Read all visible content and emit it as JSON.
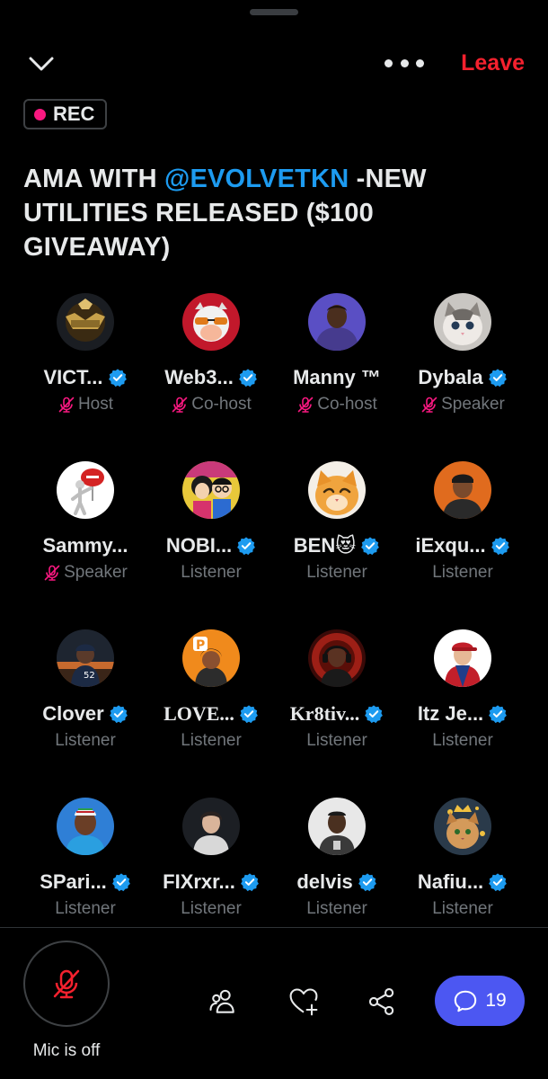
{
  "header": {
    "leave_label": "Leave",
    "collapse_icon": "chevron-down-icon",
    "more_icon": "more-horizontal-icon"
  },
  "recording": {
    "label": "REC",
    "dot_color": "#f91880"
  },
  "space": {
    "title_prefix": "AMA WITH ",
    "title_mention": "@EVOLVETKN",
    "title_suffix": " -NEW UTILITIES RELEASED ($100 GIVEAWAY)"
  },
  "participants": [
    {
      "name": "VICT...",
      "verified": true,
      "role": "Host",
      "muted": true,
      "avatar": "victor-logo-avatar"
    },
    {
      "name": "Web3...",
      "verified": true,
      "role": "Co-host",
      "muted": true,
      "avatar": "tiger-with-sunglasses-avatar"
    },
    {
      "name": "Manny ™",
      "verified": false,
      "role": "Co-host",
      "muted": true,
      "avatar": "man-in-hoodie-avatar"
    },
    {
      "name": "Dybala",
      "verified": true,
      "role": "Speaker",
      "muted": true,
      "avatar": "kitten-avatar"
    },
    {
      "name": "Sammy...",
      "verified": false,
      "role": "Speaker",
      "muted": true,
      "avatar": "urgent-sign-figure-avatar"
    },
    {
      "name": "NOBI...",
      "verified": true,
      "role": "Listener",
      "muted": false,
      "avatar": "cartoon-characters-avatar"
    },
    {
      "name": "BEN😻",
      "verified": true,
      "role": "Listener",
      "muted": false,
      "avatar": "orange-cat-avatar"
    },
    {
      "name": "iExqu...",
      "verified": true,
      "role": "Listener",
      "muted": false,
      "avatar": "man-with-cap-avatar"
    },
    {
      "name": "Clover",
      "verified": true,
      "role": "Listener",
      "muted": false,
      "avatar": "person-at-sunset-avatar"
    },
    {
      "name": "LOVE...",
      "verified": true,
      "role": "Listener",
      "muted": false,
      "avatar": "cartoon-woman-p-sign-avatar"
    },
    {
      "name": "Kr8tiv...",
      "verified": true,
      "role": "Listener",
      "muted": false,
      "avatar": "man-with-headphones-avatar"
    },
    {
      "name": "Itz Je...",
      "verified": true,
      "role": "Listener",
      "muted": false,
      "avatar": "superhero-red-cap-avatar"
    },
    {
      "name": "SPari...",
      "verified": true,
      "role": "Listener",
      "muted": false,
      "avatar": "man-in-kufi-cap-avatar"
    },
    {
      "name": "FIXrxr...",
      "verified": true,
      "role": "Listener",
      "muted": false,
      "avatar": "young-man-avatar"
    },
    {
      "name": "delvis",
      "verified": true,
      "role": "Listener",
      "muted": false,
      "avatar": "man-selfie-avatar"
    },
    {
      "name": "Nafiu...",
      "verified": true,
      "role": "Listener",
      "muted": false,
      "avatar": "cat-with-crown-avatar"
    }
  ],
  "bottom_bar": {
    "mic_label": "Mic is off",
    "mic_icon": "mic-off-icon",
    "people_icon": "people-icon",
    "react_icon": "heart-plus-icon",
    "share_icon": "share-icon",
    "chat_icon": "chat-bubble-icon",
    "chat_count": "19"
  },
  "colors": {
    "background": "#000000",
    "text": "#e7e9ea",
    "muted_text": "#71767b",
    "leave_red": "#f4212e",
    "mention_blue": "#1d9bf0",
    "verified_blue": "#1d9bf0",
    "mic_off_pink": "#f91880",
    "chat_button": "#4c57f2"
  }
}
